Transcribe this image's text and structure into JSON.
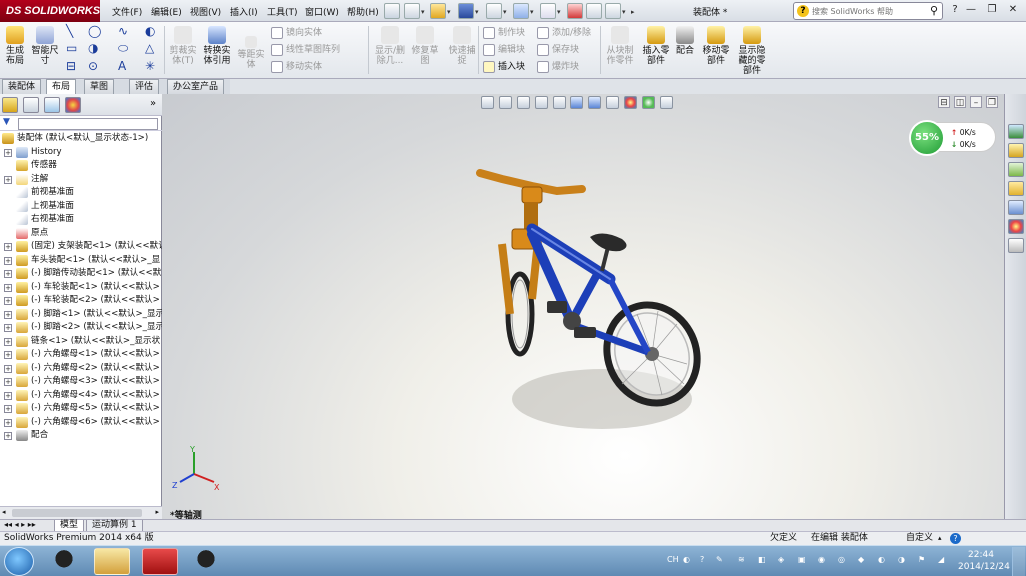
{
  "app": {
    "brand": "SOLIDWORKS",
    "brand_prefix": "DS",
    "document_title": "装配体 *"
  },
  "menu": [
    "文件(F)",
    "编辑(E)",
    "视图(V)",
    "插入(I)",
    "工具(T)",
    "窗口(W)",
    "帮助(H)"
  ],
  "search": {
    "placeholder": "搜索 SolidWorks 帮助"
  },
  "window_controls": {
    "help": "?",
    "minimize": "—",
    "restore": "❐",
    "close": "✕"
  },
  "commands": {
    "generate_layout": "生成\n布局",
    "smart_dim": "智能尺\n寸",
    "cut_entity": "剪裁实\n体(T)",
    "convert_entity": "转换实\n体引用",
    "offset_entity": "等距实\n体",
    "mirror_entity": "镜向实体",
    "linear_pattern": "线性草图阵列",
    "move_entity": "移动实体",
    "show_delete": "显示/删\n除几...",
    "repair_sketch": "修复草\n图",
    "quick_snap": "快速捕\n捉",
    "make_block": "制作块",
    "edit_block": "编辑块",
    "insert_block": "插入块",
    "add_remove": "添加/移除",
    "save_block": "保存块",
    "explode_block": "爆炸块",
    "from_block_part": "从块制\n作零件",
    "insert_part": "插入零\n部件",
    "mate": "配合",
    "move_part": "移动零\n部件",
    "show_hidden": "显示隐\n藏的零\n部件"
  },
  "tabs": [
    "装配体",
    "布局",
    "草图",
    "评估",
    "办公室产品"
  ],
  "active_tab": "布局",
  "feature_tree": [
    {
      "label": "装配体 (默认<默认_显示状态-1>)",
      "level": 0,
      "icon": "assembly-icon",
      "expand": ""
    },
    {
      "label": "History",
      "level": 1,
      "icon": "history-icon",
      "expand": "+"
    },
    {
      "label": "传感器",
      "level": 1,
      "icon": "sensor-icon",
      "expand": ""
    },
    {
      "label": "注解",
      "level": 1,
      "icon": "annotation-icon",
      "expand": "+"
    },
    {
      "label": "前视基准面",
      "level": 1,
      "icon": "plane-icon",
      "expand": ""
    },
    {
      "label": "上视基准面",
      "level": 1,
      "icon": "plane-icon",
      "expand": ""
    },
    {
      "label": "右视基准面",
      "level": 1,
      "icon": "plane-icon",
      "expand": ""
    },
    {
      "label": "原点",
      "level": 1,
      "icon": "origin-icon",
      "expand": ""
    },
    {
      "label": "(固定) 支架装配<1> (默认<<默认",
      "level": 1,
      "icon": "subassembly-icon",
      "expand": "+"
    },
    {
      "label": "车头装配<1> (默认<<默认>_显",
      "level": 1,
      "icon": "subassembly-icon",
      "expand": "+"
    },
    {
      "label": "(-) 脚踏传动装配<1> (默认<<默",
      "level": 1,
      "icon": "subassembly-icon",
      "expand": "+"
    },
    {
      "label": "(-) 车轮装配<1> (默认<<默认>",
      "level": 1,
      "icon": "subassembly-icon",
      "expand": "+"
    },
    {
      "label": "(-) 车轮装配<2> (默认<<默认>",
      "level": 1,
      "icon": "subassembly-icon",
      "expand": "+"
    },
    {
      "label": "(-) 脚踏<1> (默认<<默认>_显示",
      "level": 1,
      "icon": "part-icon",
      "expand": "+"
    },
    {
      "label": "(-) 脚踏<2> (默认<<默认>_显示",
      "level": 1,
      "icon": "part-icon",
      "expand": "+"
    },
    {
      "label": "链条<1> (默认<<默认>_显示状",
      "level": 1,
      "icon": "part-icon",
      "expand": "+"
    },
    {
      "label": "(-) 六角螺母<1> (默认<<默认>",
      "level": 1,
      "icon": "part-icon",
      "expand": "+"
    },
    {
      "label": "(-) 六角螺母<2> (默认<<默认>",
      "level": 1,
      "icon": "part-icon",
      "expand": "+"
    },
    {
      "label": "(-) 六角螺母<3> (默认<<默认>",
      "level": 1,
      "icon": "part-icon",
      "expand": "+"
    },
    {
      "label": "(-) 六角螺母<4> (默认<<默认>",
      "level": 1,
      "icon": "part-icon",
      "expand": "+"
    },
    {
      "label": "(-) 六角螺母<5> (默认<<默认>",
      "level": 1,
      "icon": "part-icon",
      "expand": "+"
    },
    {
      "label": "(-) 六角螺母<6> (默认<<默认>",
      "level": 1,
      "icon": "part-icon",
      "expand": "+"
    },
    {
      "label": "配合",
      "level": 1,
      "icon": "mates-icon",
      "expand": "+"
    }
  ],
  "viewport": {
    "view_label": "*等轴测",
    "net_percent": "55%",
    "net_up": "0K/s",
    "net_down": "0K/s",
    "triad": {
      "x": "X",
      "y": "Y",
      "z": "Z"
    }
  },
  "model_tabs": [
    "模型",
    "运动算例 1"
  ],
  "status": {
    "product": "SolidWorks Premium 2014 x64 版",
    "constraint": "欠定义",
    "editing": "在编辑 装配体",
    "units": "自定义",
    "help": "?"
  },
  "taskbar": {
    "tray_lang": "CH",
    "time": "22:44",
    "date": "2014/12/24"
  },
  "colors": {
    "brand": "#b3001b",
    "bike_frame": "#1d3fb8",
    "bike_orange": "#d98a1a"
  }
}
